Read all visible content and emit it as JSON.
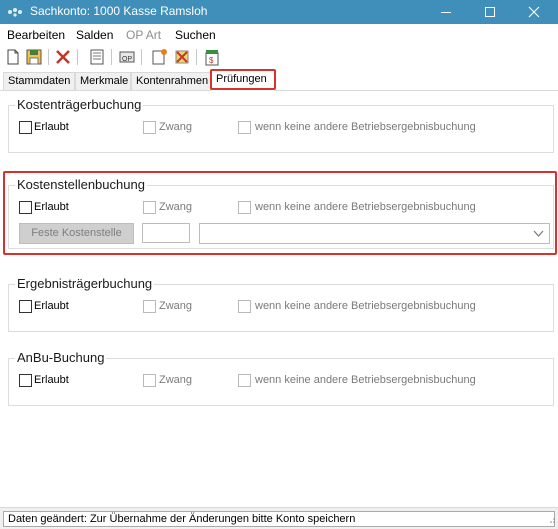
{
  "window": {
    "title": "Sachkonto: 1000 Kasse Ramsloh",
    "colors": {
      "titlebar": "#3f8fba",
      "highlight": "#d9312c"
    }
  },
  "menu": [
    {
      "label": "Bearbeiten",
      "enabled": true
    },
    {
      "label": "Salden",
      "enabled": true
    },
    {
      "label": "OP Art",
      "enabled": false
    },
    {
      "label": "Suchen",
      "enabled": true
    }
  ],
  "toolbar": {
    "icons": [
      "new-document-icon",
      "save-icon",
      "delete-icon",
      "list-view-icon",
      "open-items-icon",
      "edit-note-icon",
      "cancel-changes-icon",
      "document-settings-icon"
    ]
  },
  "tabs": [
    {
      "label": "Stammdaten",
      "active": false
    },
    {
      "label": "Merkmale",
      "active": false
    },
    {
      "label": "Kontenrahmen",
      "active": false
    },
    {
      "label": "Prüfungen",
      "active": true
    }
  ],
  "groups": {
    "kostentraeger": {
      "title": "Kostenträgerbuchung",
      "erlaubt": "Erlaubt",
      "zwang": "Zwang",
      "keine_andere": "wenn keine andere Betriebsergebnisbuchung"
    },
    "kostenstellen": {
      "title": "Kostenstellenbuchung",
      "erlaubt": "Erlaubt",
      "zwang": "Zwang",
      "keine_andere": "wenn keine andere Betriebsergebnisbuchung",
      "feste_button": "Feste Kostenstelle",
      "kst_value": "",
      "kst_select": ""
    },
    "ergebnistraeger": {
      "title": "Ergebnisträgerbuchung",
      "erlaubt": "Erlaubt",
      "zwang": "Zwang",
      "keine_andere": "wenn keine andere Betriebsergebnisbuchung"
    },
    "anbu": {
      "title": "AnBu-Buchung",
      "erlaubt": "Erlaubt",
      "zwang": "Zwang",
      "keine_andere": "wenn keine andere Betriebsergebnisbuchung"
    }
  },
  "status": {
    "message": "Daten geändert: Zur Übernahme der Änderungen bitte Konto speichern"
  }
}
